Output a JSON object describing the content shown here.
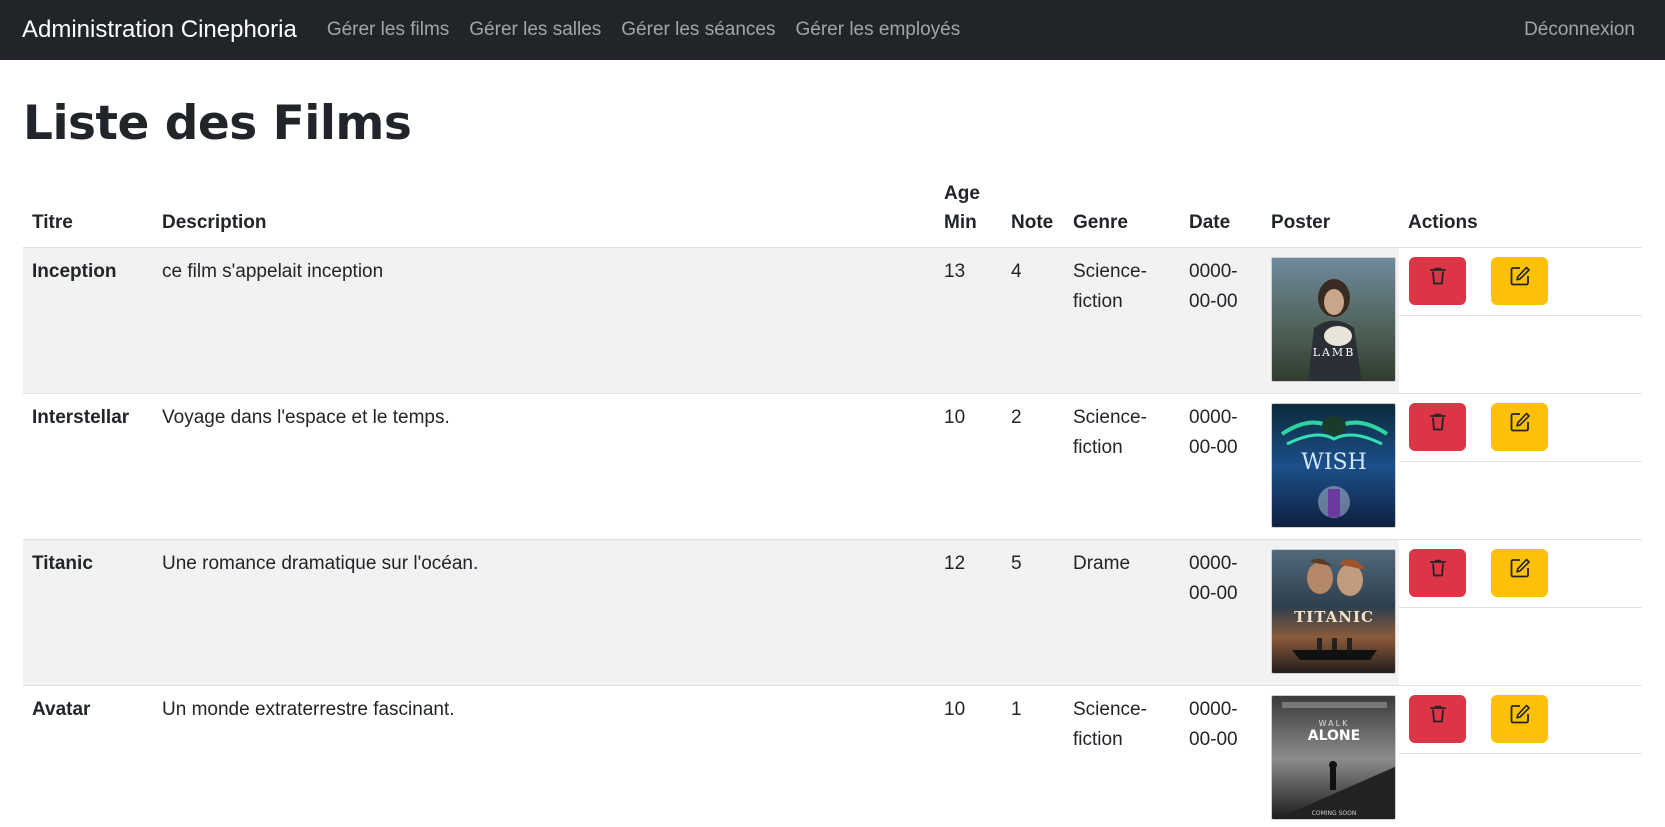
{
  "navbar": {
    "brand": "Administration Cinephoria",
    "links": [
      "Gérer les films",
      "Gérer les salles",
      "Gérer les séances",
      "Gérer les employés"
    ],
    "logout": "Déconnexion"
  },
  "page": {
    "title": "Liste des Films"
  },
  "table": {
    "headers": {
      "titre": "Titre",
      "description": "Description",
      "age_line1": "Age",
      "age_line2": "Min",
      "note": "Note",
      "genre": "Genre",
      "date": "Date",
      "poster": "Poster",
      "actions": "Actions"
    },
    "rows": [
      {
        "titre": "Inception",
        "description": "ce film s'appelait inception",
        "age": "13",
        "note": "4",
        "genre_line1": "Science-",
        "genre_line2": "fiction",
        "date_line1": "0000-",
        "date_line2": "00-00",
        "poster_text": "LAMB"
      },
      {
        "titre": "Interstellar",
        "description": "Voyage dans l'espace et le temps.",
        "age": "10",
        "note": "2",
        "genre_line1": "Science-",
        "genre_line2": "fiction",
        "date_line1": "0000-",
        "date_line2": "00-00",
        "poster_text": "WISH"
      },
      {
        "titre": "Titanic",
        "description": "Une romance dramatique sur l'océan.",
        "age": "12",
        "note": "5",
        "genre_line1": "Drame",
        "genre_line2": "",
        "date_line1": "0000-",
        "date_line2": "00-00",
        "poster_text": "TITANIC"
      },
      {
        "titre": "Avatar",
        "description": "Un monde extraterrestre fascinant.",
        "age": "10",
        "note": "1",
        "genre_line1": "Science-",
        "genre_line2": "fiction",
        "date_line1": "0000-",
        "date_line2": "00-00",
        "poster_text": "ALONE"
      }
    ],
    "delete_icon": "trash-icon",
    "edit_icon": "edit-icon"
  },
  "colors": {
    "navbar": "#212529",
    "danger": "#dc3545",
    "warning": "#ffc107",
    "stripe": "#f2f2f2"
  }
}
